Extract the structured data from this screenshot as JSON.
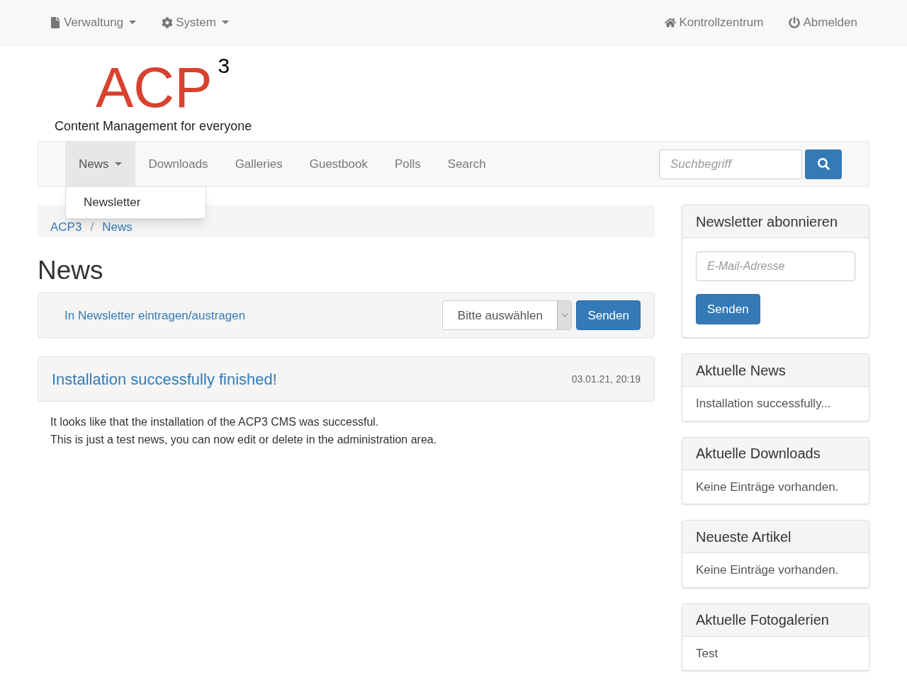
{
  "top_bar": {
    "left": [
      {
        "label": "Verwaltung",
        "dropdown": true
      },
      {
        "label": "System",
        "dropdown": true
      }
    ],
    "right": [
      {
        "label": "Kontrollzentrum",
        "dropdown": false
      },
      {
        "label": "Abmelden",
        "dropdown": false
      }
    ]
  },
  "logo": {
    "text": "ACP",
    "superscript": "3",
    "tagline": "Content Management for everyone"
  },
  "main_nav": {
    "items": [
      {
        "label": "News",
        "selected": true,
        "dropdown": true
      },
      {
        "label": "Downloads",
        "selected": false,
        "dropdown": false
      },
      {
        "label": "Galleries",
        "selected": false,
        "dropdown": false
      },
      {
        "label": "Guestbook",
        "selected": false,
        "dropdown": false
      },
      {
        "label": "Polls",
        "selected": false,
        "dropdown": false
      },
      {
        "label": "Search",
        "selected": false,
        "dropdown": false
      }
    ],
    "search": {
      "placeholder": "Suchbegriff"
    },
    "open_menu": [
      "Newsletter"
    ]
  },
  "breadcrumb": {
    "separator": "/",
    "items": [
      "ACP3",
      "News"
    ]
  },
  "page_title": "News",
  "newsletter_bar": {
    "link": "In Newsletter eintragen/austragen",
    "select": "Bitte auswählen",
    "button": "Senden"
  },
  "news": [
    {
      "title": "Installation successfully finished!",
      "date": "03.01.21, 20:19",
      "body": [
        "It looks like that the installation of the ACP3 CMS was successful.",
        "This is just a test news, you can now edit or delete in the administration area."
      ]
    }
  ],
  "sidebar": [
    {
      "kind": "form",
      "title": "Newsletter abonnieren",
      "placeholder": "E-Mail-Adresse",
      "button": "Senden"
    },
    {
      "kind": "list",
      "title": "Aktuelle News",
      "items": [
        "Installation successfully..."
      ]
    },
    {
      "kind": "list",
      "title": "Aktuelle Downloads",
      "items": [
        "Keine Einträge vorhanden."
      ]
    },
    {
      "kind": "list",
      "title": "Neueste Artikel",
      "items": [
        "Keine Einträge vorhanden."
      ]
    },
    {
      "kind": "list",
      "title": "Aktuelle Fotogalerien",
      "items": [
        "Test"
      ]
    }
  ]
}
